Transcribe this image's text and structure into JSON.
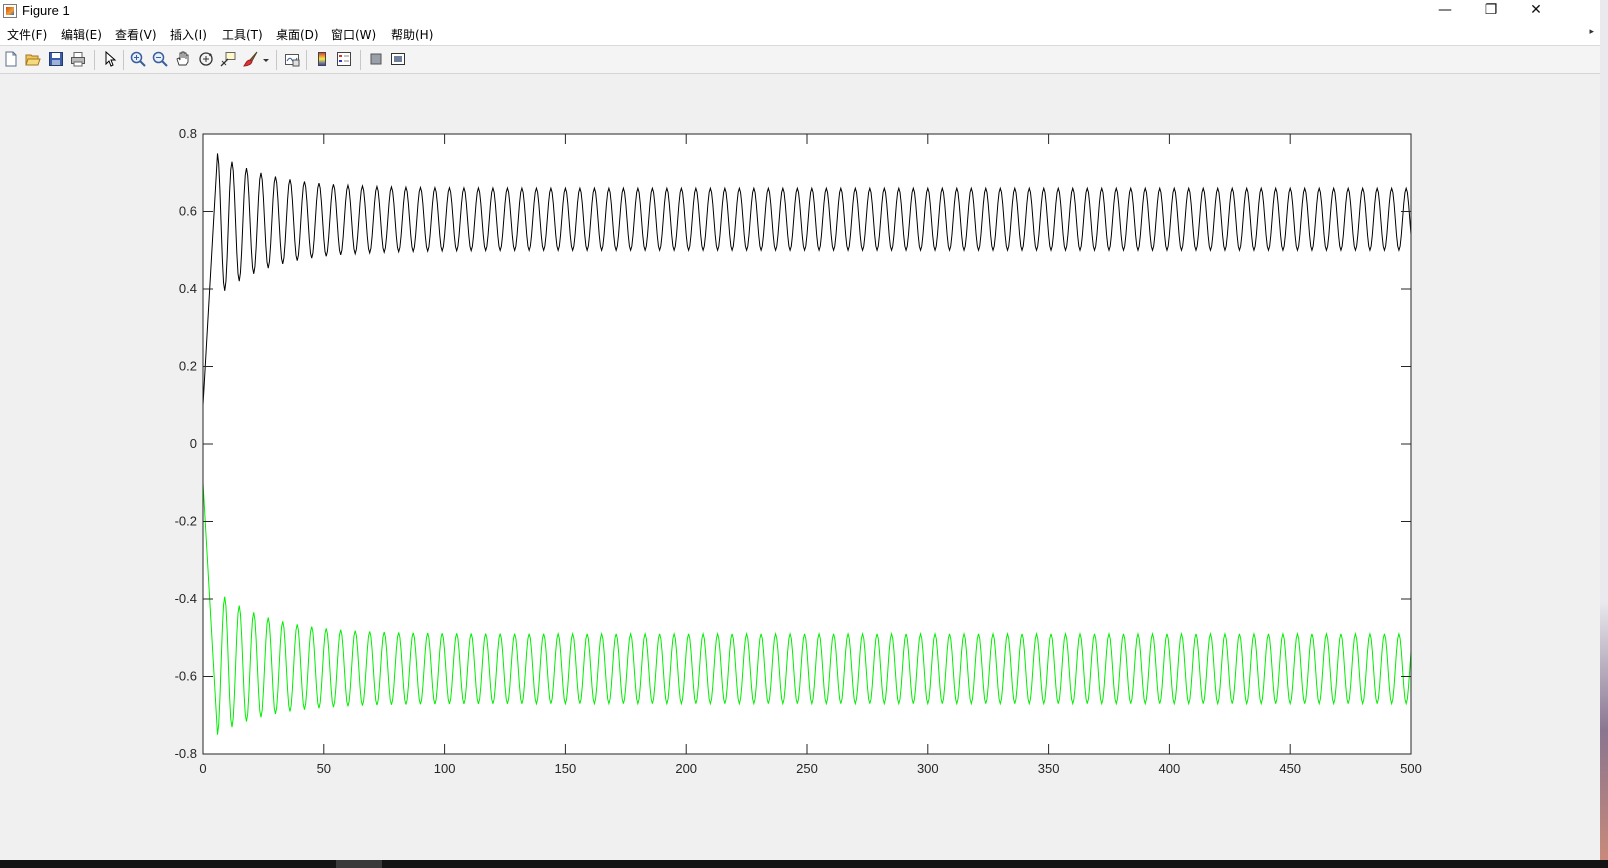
{
  "window": {
    "title": "Figure 1",
    "minimize_glyph": "—",
    "restore_glyph": "❐",
    "close_glyph": "✕"
  },
  "menu": {
    "items": [
      {
        "label": "文件(F)"
      },
      {
        "label": "编辑(E)"
      },
      {
        "label": "查看(V)"
      },
      {
        "label": "插入(I)"
      },
      {
        "label": "工具(T)"
      },
      {
        "label": "桌面(D)"
      },
      {
        "label": "窗口(W)"
      },
      {
        "label": "帮助(H)"
      }
    ]
  },
  "toolbar": {
    "icons": [
      "new-figure-icon",
      "open-file-icon",
      "save-icon",
      "print-icon",
      "edit-plot-arrow-icon",
      "zoom-in-icon",
      "zoom-out-icon",
      "pan-hand-icon",
      "rotate-3d-icon",
      "data-cursor-icon",
      "brush-icon",
      "brush-dropdown-icon",
      "link-plot-icon",
      "insert-colorbar-icon",
      "insert-legend-icon",
      "hide-plot-tools-icon",
      "show-plot-tools-icon"
    ]
  },
  "colors": {
    "series_upper": "#000000",
    "series_lower": "#00ee00",
    "axes_bg": "#ffffff",
    "figure_bg": "#f0f0f0"
  },
  "chart_data": {
    "type": "line",
    "title": "",
    "xlabel": "",
    "ylabel": "",
    "xlim": [
      0,
      500
    ],
    "ylim": [
      -0.8,
      0.8
    ],
    "grid": false,
    "xticks": [
      0,
      50,
      100,
      150,
      200,
      250,
      300,
      350,
      400,
      450,
      500
    ],
    "yticks": [
      0.8,
      0.6,
      0.4,
      0.2,
      0,
      -0.2,
      -0.4,
      -0.6,
      -0.8
    ],
    "xtick_labels": [
      "0",
      "50",
      "100",
      "150",
      "200",
      "250",
      "300",
      "350",
      "400",
      "450",
      "500"
    ],
    "ytick_labels": [
      "0.8",
      "0.6",
      "0.4",
      "0.2",
      "0",
      "-0.2",
      "-0.4",
      "-0.6",
      "-0.8"
    ],
    "series": [
      {
        "color": "#000000",
        "start_value": 0.1,
        "first_peak": 0.75,
        "first_trough": 0.38,
        "steady_max": 0.66,
        "steady_min": 0.5,
        "period": 6,
        "end_value": 0.49
      },
      {
        "color": "#00ee00",
        "start_value": -0.1,
        "first_peak": -0.75,
        "first_trough": -0.38,
        "steady_max": -0.49,
        "steady_min": -0.67,
        "period": 6,
        "end_value": -0.51
      }
    ]
  }
}
